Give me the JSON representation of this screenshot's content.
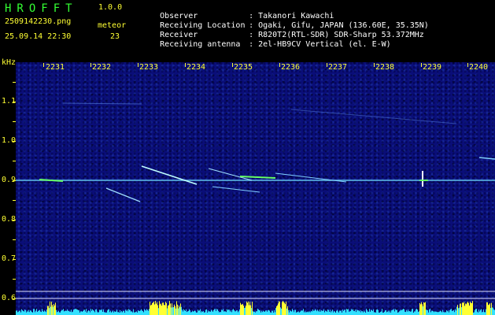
{
  "header": {
    "app_title": "HROFFT",
    "app_version": "1.0.0",
    "file_name": "2509142230.png",
    "datetime": "25.09.14 22:30",
    "meteor_label": "meteor",
    "meteor_count": "23"
  },
  "info": [
    {
      "label": "Observer",
      "value": "Takanori Kawachi"
    },
    {
      "label": "Receiving Location",
      "value": "Ogaki, Gifu, JAPAN (136.60E, 35.35N)"
    },
    {
      "label": "Receiver",
      "value": "R820T2(RTL-SDR) SDR-Sharp 53.372MHz"
    },
    {
      "label": "Receiving antenna",
      "value": "2el-HB9CV Vertical (el. E-W)"
    }
  ],
  "axis": {
    "unit": "kHz",
    "time_labels": [
      "2231",
      "2232",
      "2233",
      "2234",
      "2235",
      "2236",
      "2237",
      "2238",
      "2239",
      "2240"
    ],
    "freq_labels": [
      "1.1",
      "1.0",
      "0.9",
      "0.8",
      "0.7",
      "0.6"
    ]
  },
  "colors": {
    "background": "#000000",
    "plot_bg": "#0a0e78",
    "text_yellow": "#ffff33",
    "text_white": "#ffffff",
    "carrier_line": "#70e0ff",
    "signal_bar": "#33e0ff",
    "signal_peak": "#ffff33"
  }
}
